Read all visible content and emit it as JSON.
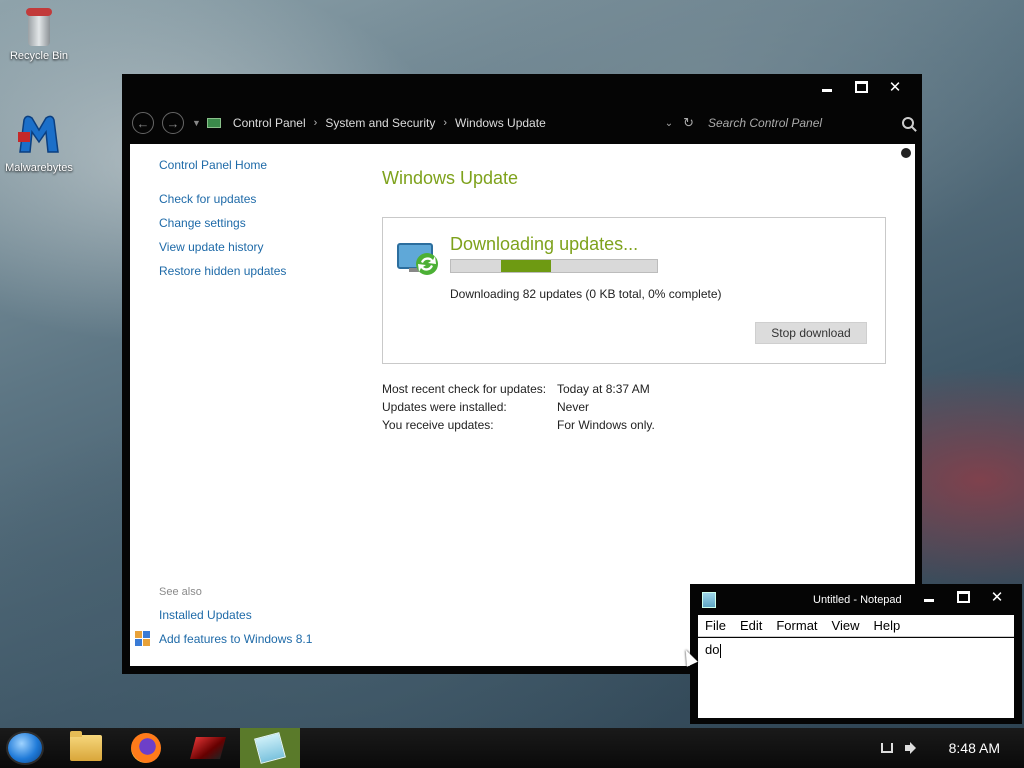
{
  "desktop": {
    "icons": [
      {
        "label": "Recycle Bin",
        "icon": "recycle-bin-icon"
      },
      {
        "label": "Malwarebytes",
        "icon": "malwarebytes-icon"
      }
    ]
  },
  "control_panel": {
    "breadcrumb": [
      "Control Panel",
      "System and Security",
      "Windows Update"
    ],
    "search_placeholder": "Search Control Panel",
    "sidebar": {
      "home": "Control Panel Home",
      "links": [
        "Check for updates",
        "Change settings",
        "View update history",
        "Restore hidden updates"
      ]
    },
    "see_also": {
      "title": "See also",
      "links": [
        "Installed Updates",
        "Add features to Windows 8.1"
      ]
    },
    "main": {
      "title": "Windows Update",
      "update_heading": "Downloading updates...",
      "status": "Downloading 82 updates (0 KB total, 0% complete)",
      "progress_percent": 0,
      "stop_button": "Stop download",
      "info": [
        {
          "label": "Most recent check for updates:",
          "value": "Today at 8:37 AM"
        },
        {
          "label": "Updates were installed:",
          "value": "Never"
        },
        {
          "label": "You receive updates:",
          "value": "For Windows only."
        }
      ]
    },
    "colors": {
      "accent_green": "#7ea21c",
      "link_blue": "#1e6aa8",
      "progress_fill": "#6e9a12"
    }
  },
  "notepad": {
    "title": "Untitled - Notepad",
    "menu": [
      "File",
      "Edit",
      "Format",
      "View",
      "Help"
    ],
    "content": "do"
  },
  "taskbar": {
    "apps": [
      "file-explorer-icon",
      "firefox-icon",
      "red-app-icon",
      "notepad-icon"
    ],
    "clock": "8:48 AM"
  }
}
